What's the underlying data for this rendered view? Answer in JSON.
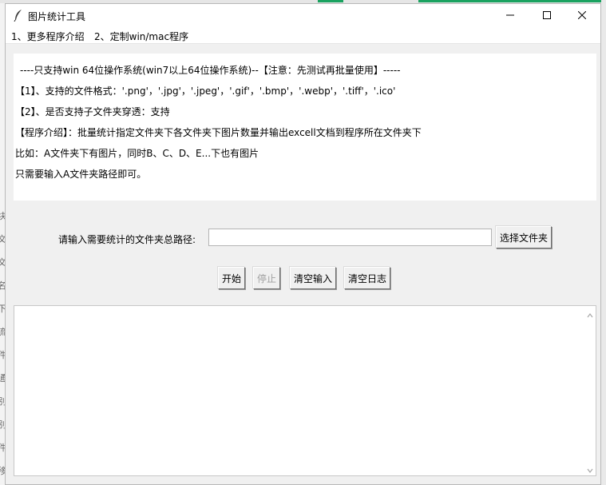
{
  "window": {
    "title": "图片统计工具"
  },
  "menu": {
    "items": [
      {
        "label": "1、更多程序介绍"
      },
      {
        "label": "2、定制win/mac程序"
      }
    ]
  },
  "info": {
    "lines": [
      "----只支持win 64位操作系统(win7以上64位操作系统)--【注意：先测试再批量使用】-----",
      "【1】、支持的文件格式：'.png'，'.jpg'，'.jpeg'，'.gif'，'.bmp'，'.webp'，'.tiff'，'.ico'",
      "【2】、是否支持子文件夹穿透：支持",
      "【程序介绍】：批量统计指定文件夹下各文件夹下图片数量并输出excell文档到程序所在文件夹下",
      "比如：A文件夹下有图片，同时B、C、D、E...下也有图片",
      "只需要输入A文件夹路径即可。"
    ]
  },
  "form": {
    "path_label": "请输入需要统计的文件夹总路径:",
    "path_value": "",
    "choose_folder_label": "选择文件夹"
  },
  "actions": {
    "start_label": "开始",
    "stop_label": "停止",
    "clear_input_label": "清空输入",
    "clear_log_label": "清空日志"
  },
  "log": {
    "content": ""
  },
  "background_glyphs": [
    "块",
    "文",
    "文",
    "名",
    "下",
    "流",
    "件",
    "通",
    "别",
    "别",
    "件",
    "移"
  ],
  "colors": {
    "window_bg": "#f0f0f0",
    "titlebar_bg": "#ffffff",
    "accent_green": "#1aa260",
    "disabled_text": "#a0a0a0"
  }
}
